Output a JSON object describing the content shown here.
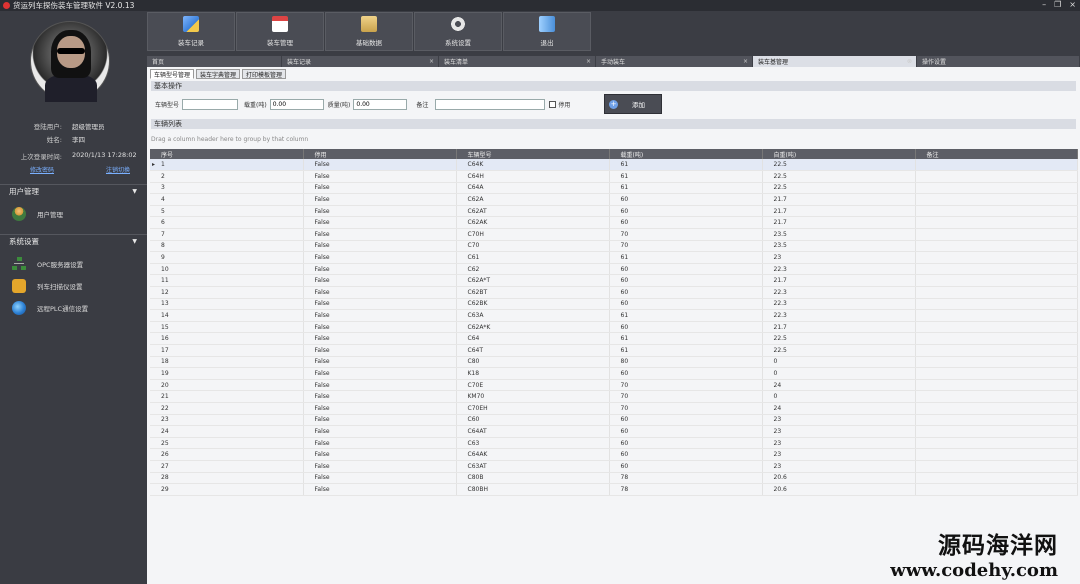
{
  "app": {
    "title": "货运列车探伤装车管理软件 V2.0.13"
  },
  "window_controls": {
    "minimize": "–",
    "restore": "❐",
    "close": "×"
  },
  "user": {
    "login_user_label": "登陆用户:",
    "login_user_value": "超级管理员",
    "name_label": "姓名:",
    "name_value": "李四",
    "last_login_label": "上次登录时间:",
    "last_login_value": "2020/1/13 17:28:02",
    "change_password": "修改密码",
    "logout": "注销切换"
  },
  "sidebar": {
    "sections": [
      {
        "title": "用户管理",
        "items": [
          {
            "label": "用户管理",
            "icon": "user-icon"
          }
        ]
      },
      {
        "title": "系统设置",
        "items": [
          {
            "label": "OPC服务器设置",
            "icon": "server-network-icon"
          },
          {
            "label": "列车扫描仪设置",
            "icon": "train-icon"
          },
          {
            "label": "远程PLC通信设置",
            "icon": "globe-icon"
          }
        ]
      }
    ],
    "chevron": "▼"
  },
  "toolbar": {
    "buttons": [
      {
        "label": "装车记录",
        "icon": "edit-record-icon"
      },
      {
        "label": "装车管理",
        "icon": "calendar-manage-icon"
      },
      {
        "label": "基础数据",
        "icon": "data-settings-icon"
      },
      {
        "label": "系统设置",
        "icon": "gear-icon"
      },
      {
        "label": "退出",
        "icon": "exit-icon"
      }
    ]
  },
  "doc_tabs": [
    {
      "label": "首页",
      "close": ""
    },
    {
      "label": "装车记录",
      "close": "×"
    },
    {
      "label": "装车清单",
      "close": "×"
    },
    {
      "label": "手动装车",
      "close": "×"
    },
    {
      "label": "装车基管理",
      "close": "⊗"
    },
    {
      "label": "操作设置",
      "close": ""
    }
  ],
  "sub_tabs": [
    "车辆型号管理",
    "装车字典管理",
    "打印模板管理"
  ],
  "basic_ops": {
    "title": "基本操作",
    "model_label": "车辆型号",
    "model_value": "",
    "load_label": "载重(吨)",
    "load_value": "0.00",
    "weight_label": "质量(吨)",
    "weight_value": "0.00",
    "remark_label": "备注",
    "remark_value": "",
    "disabled_label": "停用",
    "add_label": "添加",
    "add_icon": "+"
  },
  "list": {
    "title": "车辆列表",
    "group_hint": "Drag a column header here to group by that column",
    "columns": [
      "序号",
      "停用",
      "车辆型号",
      "载重(吨)",
      "自重(吨)",
      "备注"
    ],
    "selected_marker": "▸",
    "rows": [
      [
        "1",
        "False",
        "C64K",
        "61",
        "22.5",
        ""
      ],
      [
        "2",
        "False",
        "C64H",
        "61",
        "22.5",
        ""
      ],
      [
        "3",
        "False",
        "C64A",
        "61",
        "22.5",
        ""
      ],
      [
        "4",
        "False",
        "C62A",
        "60",
        "21.7",
        ""
      ],
      [
        "5",
        "False",
        "C62AT",
        "60",
        "21.7",
        ""
      ],
      [
        "6",
        "False",
        "C62AK",
        "60",
        "21.7",
        ""
      ],
      [
        "7",
        "False",
        "C70H",
        "70",
        "23.5",
        ""
      ],
      [
        "8",
        "False",
        "C70",
        "70",
        "23.5",
        ""
      ],
      [
        "9",
        "False",
        "C61",
        "61",
        "23",
        ""
      ],
      [
        "10",
        "False",
        "C62",
        "60",
        "22.3",
        ""
      ],
      [
        "11",
        "False",
        "C62A*T",
        "60",
        "21.7",
        ""
      ],
      [
        "12",
        "False",
        "C62BT",
        "60",
        "22.3",
        ""
      ],
      [
        "13",
        "False",
        "C62BK",
        "60",
        "22.3",
        ""
      ],
      [
        "14",
        "False",
        "C63A",
        "61",
        "22.3",
        ""
      ],
      [
        "15",
        "False",
        "C62A*K",
        "60",
        "21.7",
        ""
      ],
      [
        "16",
        "False",
        "C64",
        "61",
        "22.5",
        ""
      ],
      [
        "17",
        "False",
        "C64T",
        "61",
        "22.5",
        ""
      ],
      [
        "18",
        "False",
        "C80",
        "80",
        "0",
        ""
      ],
      [
        "19",
        "False",
        "K18",
        "60",
        "0",
        ""
      ],
      [
        "20",
        "False",
        "C70E",
        "70",
        "24",
        ""
      ],
      [
        "21",
        "False",
        "KM70",
        "70",
        "0",
        ""
      ],
      [
        "22",
        "False",
        "C70EH",
        "70",
        "24",
        ""
      ],
      [
        "23",
        "False",
        "C60",
        "60",
        "23",
        ""
      ],
      [
        "24",
        "False",
        "C64AT",
        "60",
        "23",
        ""
      ],
      [
        "25",
        "False",
        "C63",
        "60",
        "23",
        ""
      ],
      [
        "26",
        "False",
        "C64AK",
        "60",
        "23",
        ""
      ],
      [
        "27",
        "False",
        "C63AT",
        "60",
        "23",
        ""
      ],
      [
        "28",
        "False",
        "C80B",
        "78",
        "20.6",
        ""
      ],
      [
        "29",
        "False",
        "C80BH",
        "78",
        "20.6",
        ""
      ]
    ]
  },
  "watermark": {
    "line1": "源码海洋网",
    "line2": "www.codehy.com"
  },
  "colors": {
    "accent": "#6fa0e8",
    "sidebar_bg": "#3a3c43",
    "header_bg": "#5c5e66"
  }
}
